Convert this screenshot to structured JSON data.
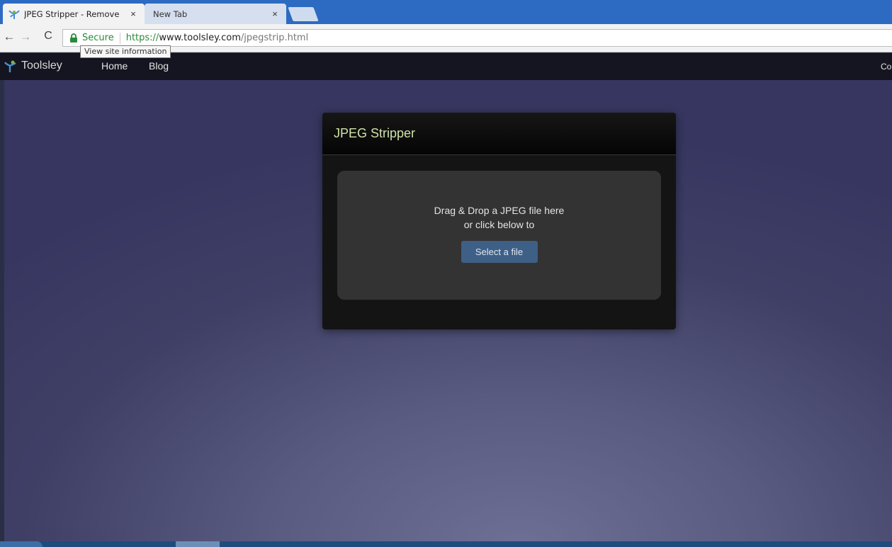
{
  "browser": {
    "tabs": [
      {
        "title": "JPEG Stripper - Remove",
        "close": "×"
      },
      {
        "title": "New Tab",
        "close": "×"
      }
    ],
    "nav": {
      "back": "←",
      "forward": "→",
      "reload": "C"
    },
    "address": {
      "secure_label": "Secure",
      "url_scheme": "https://",
      "url_host": "www.toolsley.com",
      "url_path": "/jpegstrip.html"
    },
    "tooltip": "View site information"
  },
  "site": {
    "brand": "Toolsley",
    "nav": {
      "home": "Home",
      "blog": "Blog",
      "right_cut": "Co"
    }
  },
  "card": {
    "title": "JPEG Stripper",
    "drop_line1": "Drag & Drop a JPEG file here",
    "drop_line2": "or click below to",
    "button": "Select a file"
  },
  "colors": {
    "tabstrip": "#2d6bc2",
    "card_title": "#cfe3a9",
    "button": "#3e5f86",
    "secure_green": "#2a8a3a"
  }
}
